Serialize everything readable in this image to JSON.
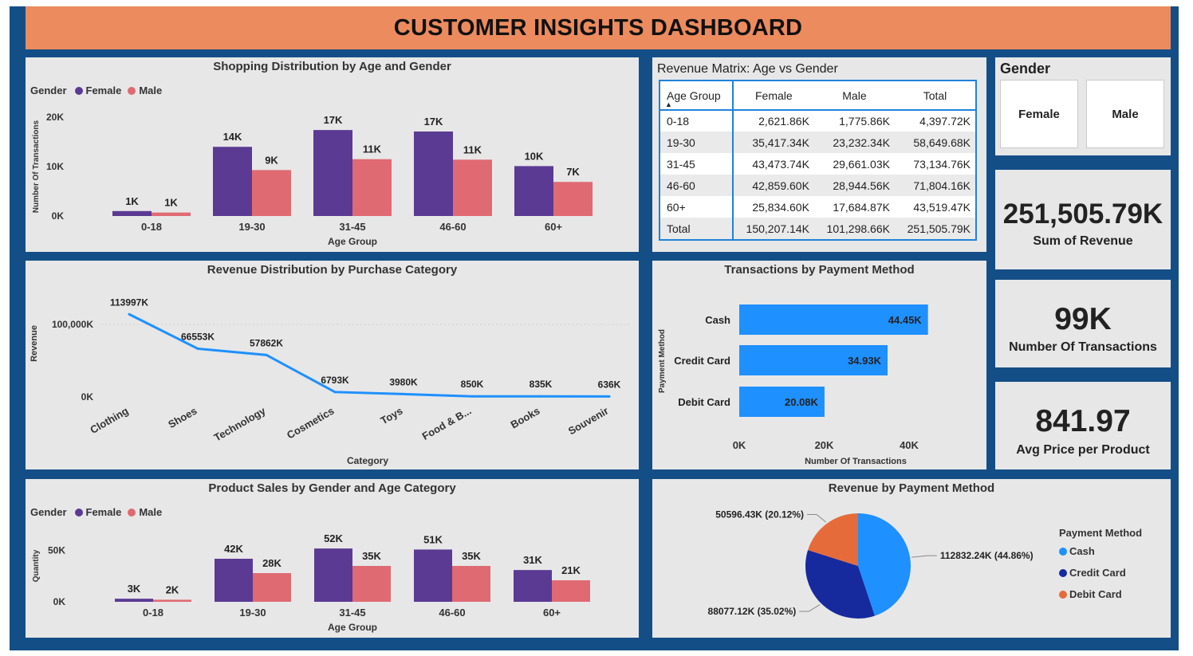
{
  "dashboard": {
    "title": "CUSTOMER INSIGHTS DASHBOARD"
  },
  "colors": {
    "female": "#5b3a93",
    "male": "#e06a72",
    "cash": "#1e90ff",
    "credit_card": "#162a9e",
    "debit_card": "#e66b3a",
    "header": "#ec8b5e",
    "frame": "#144e87"
  },
  "age_gender_chart": {
    "title": "Shopping Distribution by Age and Gender",
    "legend_title": "Gender",
    "legend": [
      "Female",
      "Male"
    ],
    "xlabel": "Age Group",
    "ylabel": "Number Of Transactions",
    "yticks": [
      "20K",
      "10K",
      "0K"
    ]
  },
  "category_chart": {
    "title": "Revenue Distribution by Purchase Category",
    "xlabel": "Category",
    "ylabel": "Revenue",
    "yticks": [
      "100,000K",
      "0K"
    ]
  },
  "product_sales_chart": {
    "title": "Product Sales by Gender and Age Category",
    "legend_title": "Gender",
    "legend": [
      "Female",
      "Male"
    ],
    "xlabel": "Age Group",
    "ylabel": "Quantity",
    "yticks": [
      "50K",
      "0K"
    ]
  },
  "matrix": {
    "title": "Revenue Matrix: Age vs Gender",
    "headers": [
      "Age Group",
      "Female",
      "Male",
      "Total"
    ],
    "rows": [
      [
        "0-18",
        "2,621.86K",
        "1,775.86K",
        "4,397.72K"
      ],
      [
        "19-30",
        "35,417.34K",
        "23,232.34K",
        "58,649.68K"
      ],
      [
        "31-45",
        "43,473.74K",
        "29,661.03K",
        "73,134.76K"
      ],
      [
        "46-60",
        "42,859.60K",
        "28,944.56K",
        "71,804.16K"
      ],
      [
        "60+",
        "25,834.60K",
        "17,684.87K",
        "43,519.47K"
      ],
      [
        "Total",
        "150,207.14K",
        "101,298.66K",
        "251,505.79K"
      ]
    ]
  },
  "slicer": {
    "title": "Gender",
    "options": [
      "Female",
      "Male"
    ]
  },
  "kpis": {
    "revenue": {
      "value": "251,505.79K",
      "label": "Sum of Revenue"
    },
    "transactions": {
      "value": "99K",
      "label": "Number Of Transactions"
    },
    "avg_price": {
      "value": "841.97",
      "label": "Avg Price per Product"
    }
  },
  "payment_bar_chart": {
    "title": "Transactions by Payment Method",
    "xlabel": "Number Of Transactions",
    "ylabel": "Payment Method",
    "xticks": [
      "0K",
      "20K",
      "40K"
    ]
  },
  "payment_pie_chart": {
    "title": "Revenue by Payment Method",
    "legend_title": "Payment Method",
    "legend": [
      "Cash",
      "Credit Card",
      "Debit Card"
    ]
  },
  "chart_data": [
    {
      "id": "age_gender",
      "type": "bar",
      "title": "Shopping Distribution by Age and Gender",
      "xlabel": "Age Group",
      "ylabel": "Number Of Transactions",
      "categories": [
        "0-18",
        "19-30",
        "31-45",
        "46-60",
        "60+"
      ],
      "series": [
        {
          "name": "Female",
          "values": [
            1000,
            14000,
            17400,
            17100,
            10100
          ],
          "labels": [
            "1K",
            "14K",
            "17K",
            "17K",
            "10K"
          ]
        },
        {
          "name": "Male",
          "values": [
            700,
            9300,
            11500,
            11400,
            6900
          ],
          "labels": [
            "1K",
            "9K",
            "11K",
            "11K",
            "7K"
          ]
        }
      ],
      "ylim": [
        0,
        20000
      ],
      "legend": "top-left"
    },
    {
      "id": "category_revenue",
      "type": "line",
      "title": "Revenue Distribution by Purchase Category",
      "xlabel": "Category",
      "ylabel": "Revenue",
      "categories": [
        "Clothing",
        "Shoes",
        "Technology",
        "Cosmetics",
        "Toys",
        "Food & B...",
        "Books",
        "Souvenir"
      ],
      "values": [
        113997,
        66553,
        57862,
        6793,
        3980,
        850,
        835,
        636
      ],
      "labels": [
        "113997K",
        "66553K",
        "57862K",
        "6793K",
        "3980K",
        "850K",
        "835K",
        "636K"
      ],
      "ylim": [
        0,
        125000
      ]
    },
    {
      "id": "product_sales",
      "type": "bar",
      "title": "Product Sales by Gender and Age Category",
      "xlabel": "Age Group",
      "ylabel": "Quantity",
      "categories": [
        "0-18",
        "19-30",
        "31-45",
        "46-60",
        "60+"
      ],
      "series": [
        {
          "name": "Female",
          "values": [
            3000,
            42000,
            52000,
            51000,
            31000
          ],
          "labels": [
            "3K",
            "42K",
            "52K",
            "51K",
            "31K"
          ]
        },
        {
          "name": "Male",
          "values": [
            2000,
            28000,
            35000,
            35000,
            21000
          ],
          "labels": [
            "2K",
            "28K",
            "35K",
            "35K",
            "21K"
          ]
        }
      ],
      "ylim": [
        0,
        70000
      ],
      "legend": "top-left"
    },
    {
      "id": "payment_transactions",
      "type": "bar",
      "orientation": "horizontal",
      "title": "Transactions by Payment Method",
      "xlabel": "Number Of Transactions",
      "ylabel": "Payment Method",
      "categories": [
        "Cash",
        "Credit Card",
        "Debit Card"
      ],
      "values": [
        44450,
        34930,
        20080
      ],
      "labels": [
        "44.45K",
        "34.93K",
        "20.08K"
      ],
      "xlim": [
        0,
        45000
      ]
    },
    {
      "id": "payment_revenue",
      "type": "pie",
      "title": "Revenue by Payment Method",
      "categories": [
        "Cash",
        "Credit Card",
        "Debit Card"
      ],
      "values": [
        112832.24,
        88077.12,
        50596.43
      ],
      "labels": [
        "112832.24K (44.86%)",
        "88077.12K (35.02%)",
        "50596.43K (20.12%)"
      ],
      "legend": "right"
    }
  ]
}
